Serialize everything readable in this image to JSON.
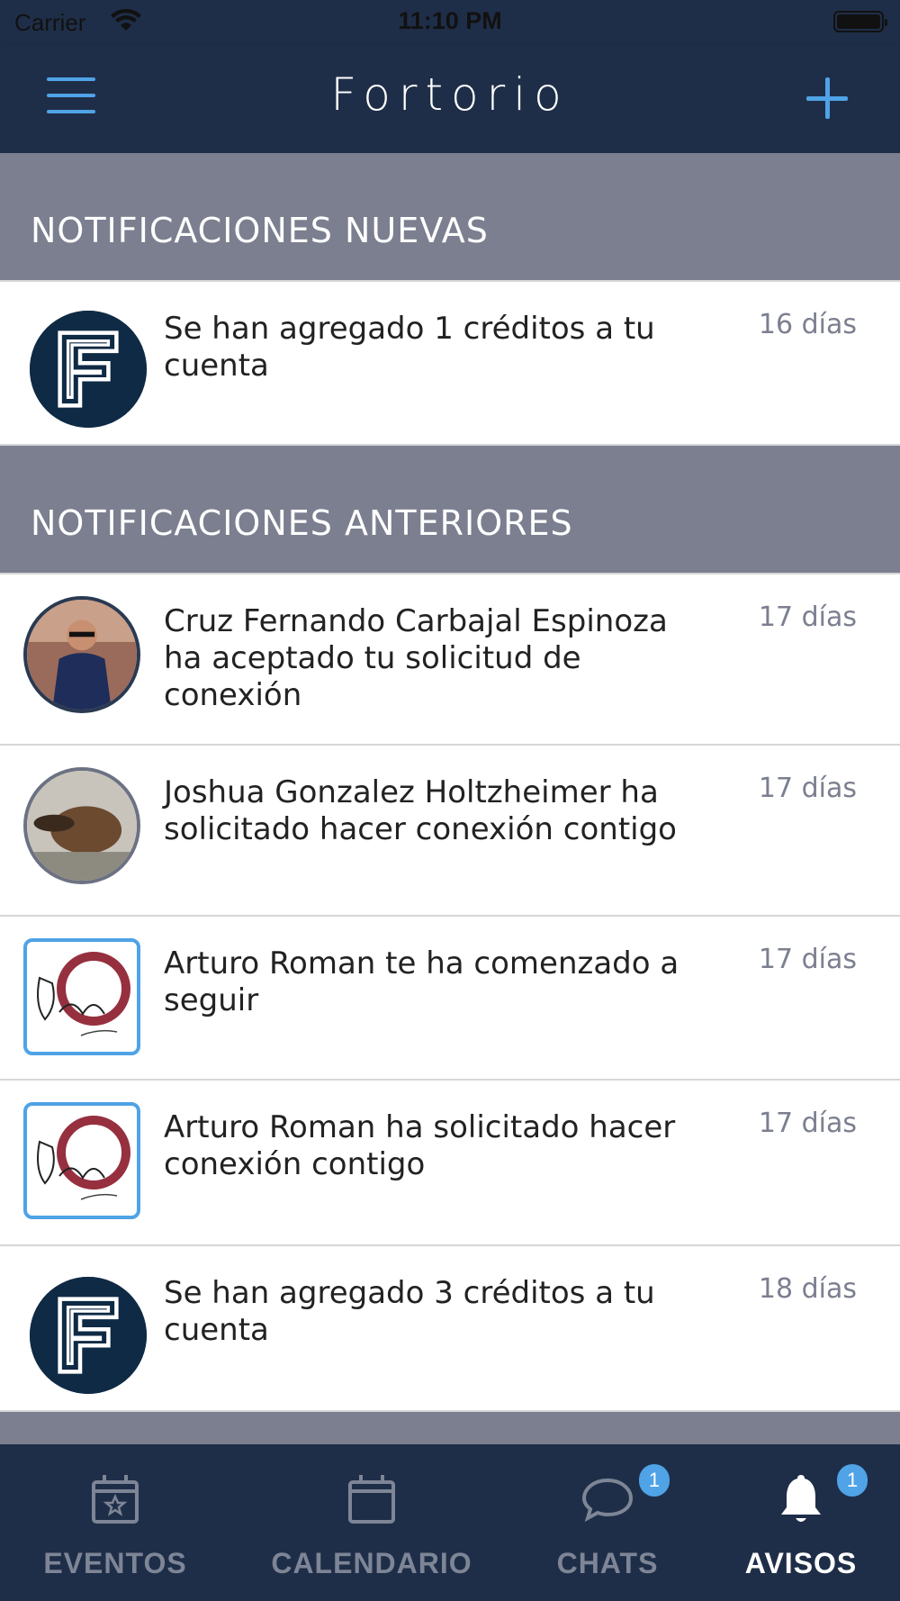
{
  "status_bar": {
    "carrier": "Carrier",
    "time": "11:10 PM"
  },
  "nav": {
    "title": "Fortorio",
    "menu_icon": "hamburger-menu-icon",
    "add_icon": "plus-icon"
  },
  "sections": {
    "new": {
      "title": "NOTIFICACIONES NUEVAS",
      "items": [
        {
          "text": "Se han agregado 1 créditos a tu cuenta",
          "time": "16 días",
          "avatar": "fortorio-logo"
        }
      ]
    },
    "old": {
      "title": "NOTIFICACIONES ANTERIORES",
      "items": [
        {
          "text": "Cruz Fernando Carbajal Espinoza ha aceptado tu solicitud de conexión",
          "time": "17 días",
          "avatar": "user-photo"
        },
        {
          "text": "Joshua Gonzalez Holtzheimer ha solicitado hacer conexión contigo",
          "time": "17 días",
          "avatar": "user-photo"
        },
        {
          "text": "Arturo Roman te ha comenzado a seguir",
          "time": "17 días",
          "avatar": "dela-banquetes-logo"
        },
        {
          "text": "Arturo Roman ha solicitado hacer conexión contigo",
          "time": "17 días",
          "avatar": "dela-banquetes-logo"
        },
        {
          "text": "Se han agregado 3 créditos a tu cuenta",
          "time": "18 días",
          "avatar": "fortorio-logo"
        }
      ]
    }
  },
  "tabs": [
    {
      "label": "EVENTOS",
      "icon": "calendar-star-icon",
      "active": false,
      "badge": ""
    },
    {
      "label": "CALENDARIO",
      "icon": "calendar-icon",
      "active": false,
      "badge": ""
    },
    {
      "label": "CHATS",
      "icon": "chat-bubble-icon",
      "active": false,
      "badge": "1"
    },
    {
      "label": "AVISOS",
      "icon": "bell-icon",
      "active": true,
      "badge": "1"
    }
  ],
  "colors": {
    "nav_background": "#1f2e48",
    "accent": "#4fa3e6",
    "section_header": "#7b7f8f",
    "fortorio_logo_bg": "#0f2a45",
    "dela_logo_red": "#8b1a2a"
  }
}
